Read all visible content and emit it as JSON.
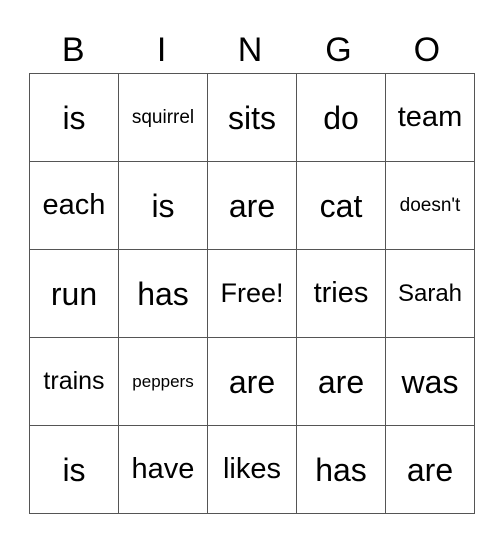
{
  "header": [
    "B",
    "I",
    "N",
    "G",
    "O"
  ],
  "rows": [
    [
      "is",
      "squirrel",
      "sits",
      "do",
      "team"
    ],
    [
      "each",
      "is",
      "are",
      "cat",
      "doesn't"
    ],
    [
      "run",
      "has",
      "Free!",
      "tries",
      "Sarah"
    ],
    [
      "trains",
      "peppers",
      "are",
      "are",
      "was"
    ],
    [
      "is",
      "have",
      "likes",
      "has",
      "are"
    ]
  ]
}
